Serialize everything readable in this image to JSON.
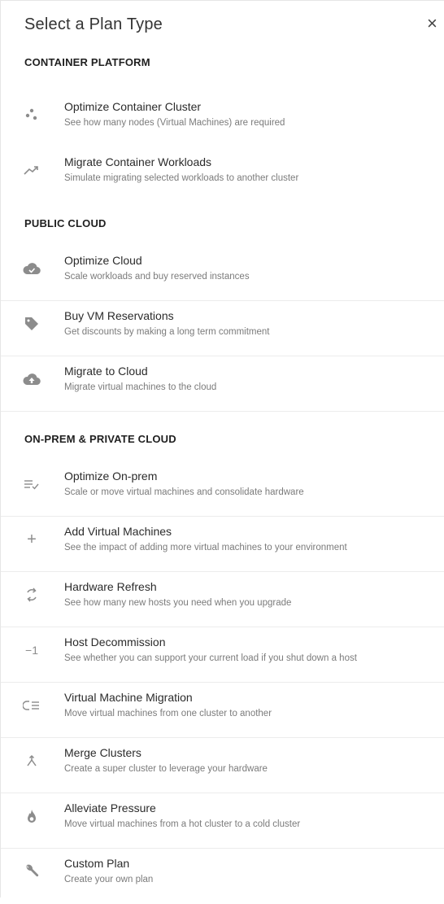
{
  "dialog": {
    "title": "Select a Plan Type",
    "close_glyph": "×"
  },
  "sections": [
    {
      "title": "CONTAINER PLATFORM",
      "items": [
        {
          "name": "Optimize Container Cluster",
          "description": "See how many nodes (Virtual Machines) are required",
          "icon": "container-cluster-icon"
        },
        {
          "name": "Migrate Container Workloads",
          "description": "Simulate migrating selected workloads to another cluster",
          "icon": "trend-arrow-icon"
        }
      ]
    },
    {
      "title": "PUBLIC CLOUD",
      "items": [
        {
          "name": "Optimize Cloud",
          "description": "Scale workloads and buy reserved instances",
          "icon": "cloud-check-icon"
        },
        {
          "name": "Buy VM Reservations",
          "description": "Get discounts by making a long term commitment",
          "icon": "tag-icon"
        },
        {
          "name": "Migrate to Cloud",
          "description": "Migrate virtual machines to the cloud",
          "icon": "cloud-upload-icon"
        }
      ]
    },
    {
      "title": "ON-PREM & PRIVATE CLOUD",
      "items": [
        {
          "name": "Optimize On-prem",
          "description": "Scale or move virtual machines and consolidate hardware",
          "icon": "list-check-icon"
        },
        {
          "name": "Add Virtual Machines",
          "description": "See the impact of adding more virtual machines to your environment",
          "icon": "plus-icon"
        },
        {
          "name": "Hardware Refresh",
          "description": "See how many new hosts you need when you upgrade",
          "icon": "refresh-icon"
        },
        {
          "name": "Host Decommission",
          "description": "See whether you can support your current load if you shut down a host",
          "icon": "minus-one-icon"
        },
        {
          "name": "Virtual Machine Migration",
          "description": "Move virtual machines from one cluster to another",
          "icon": "migrate-list-icon"
        },
        {
          "name": "Merge Clusters",
          "description": "Create a super cluster to leverage your hardware",
          "icon": "merge-icon"
        },
        {
          "name": "Alleviate Pressure",
          "description": "Move virtual machines from a hot cluster to a cold cluster",
          "icon": "flame-icon"
        },
        {
          "name": "Custom Plan",
          "description": "Create your own plan",
          "icon": "wrench-icon"
        }
      ]
    }
  ],
  "icon_glyphs": {
    "minus_one": "−1",
    "plus": "+"
  }
}
